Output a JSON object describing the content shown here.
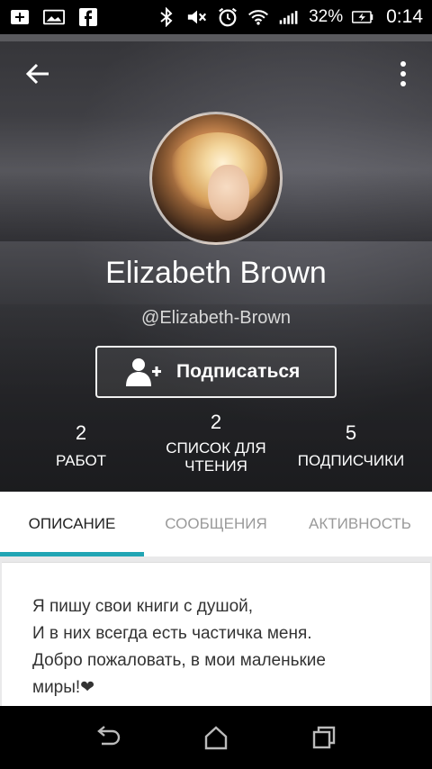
{
  "status_bar": {
    "battery_percent": "32%",
    "time": "0:14",
    "icons": [
      "add-icon",
      "image-icon",
      "facebook-icon",
      "bluetooth-icon",
      "mute-icon",
      "alarm-icon",
      "wifi-icon",
      "signal-icon",
      "battery-icon"
    ]
  },
  "profile": {
    "name": "Elizabeth Brown",
    "handle": "@Elizabeth-Brown",
    "follow_label": "Подписаться",
    "stats": [
      {
        "value": "2",
        "label": "РАБОТ"
      },
      {
        "value": "2",
        "label": "СПИСОК ДЛЯ ЧТЕНИЯ"
      },
      {
        "value": "5",
        "label": "ПОДПИСЧИКИ"
      }
    ]
  },
  "tabs": [
    {
      "label": "ОПИСАНИЕ",
      "active": true
    },
    {
      "label": "СООБЩЕНИЯ",
      "active": false
    },
    {
      "label": "АКТИВНОСТЬ",
      "active": false
    }
  ],
  "description": {
    "lines": [
      "Я пишу свои книги с душой,",
      "И в них всегда есть частичка меня.",
      "Добро пожаловать, в мои маленькие",
      "миры!❤"
    ]
  },
  "colors": {
    "accent": "#21a5b4",
    "tab_inactive": "#9a9a9a",
    "tab_active": "#222222"
  }
}
